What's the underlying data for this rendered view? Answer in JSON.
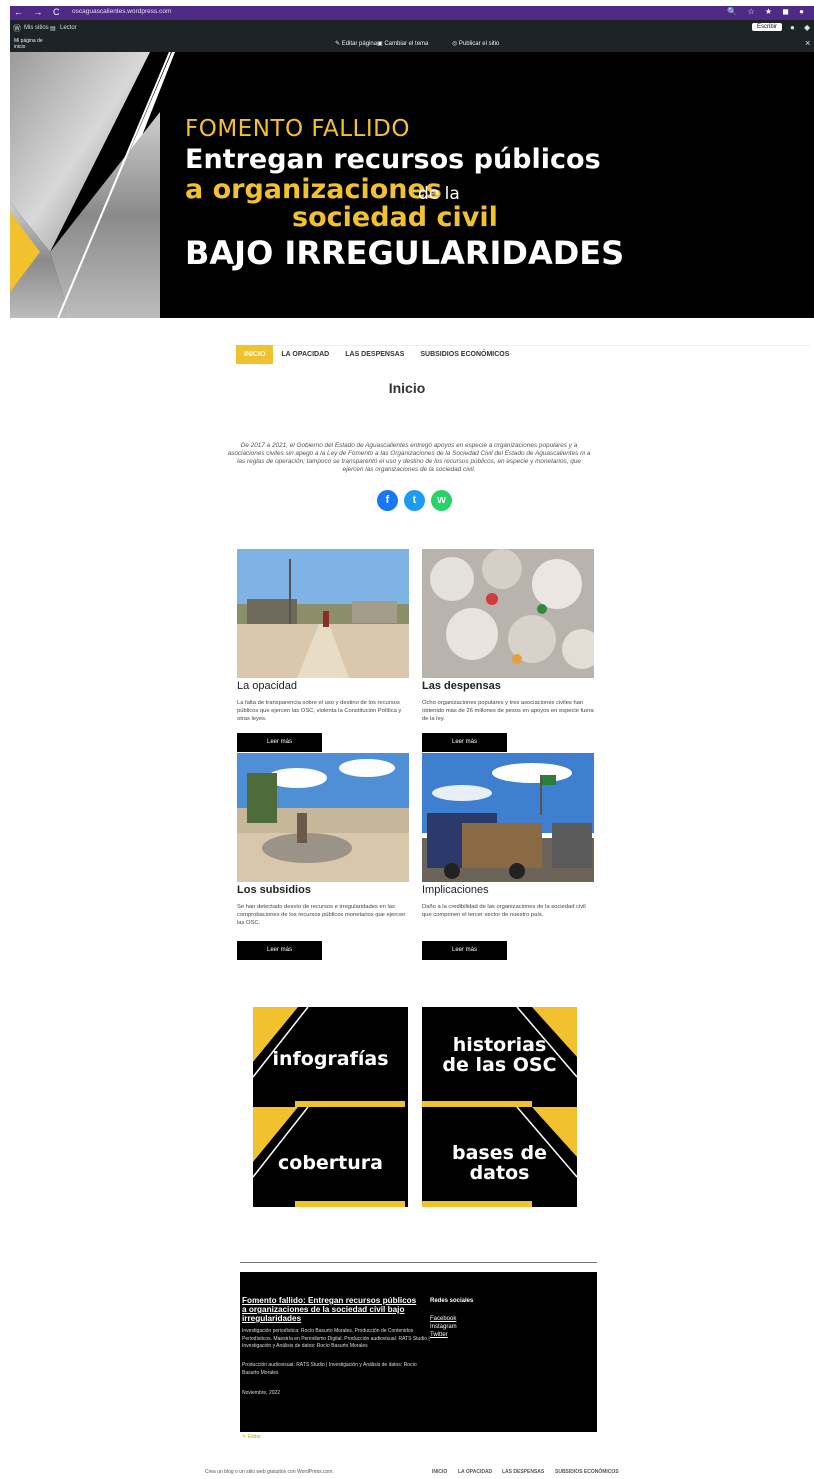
{
  "browser": {
    "url": "oscaguascalientes.wordpress.com",
    "nav_glyphs": "← → C",
    "right_glyphs": "🔍 ☆ ★ ◼ ●"
  },
  "admin_bar": {
    "my_sites": "Mis sitios",
    "reader": "Lector",
    "my_page": "Mi página de inicio",
    "edit_page": "Editar página",
    "change_theme": "Cambiar el tema",
    "publish_site": "Publicar el sitio",
    "write": "Escribir",
    "close": "×"
  },
  "hero": {
    "line1": "FOMENTO FALLIDO",
    "line2": "Entregan recursos públicos",
    "line3": "a organizaciones",
    "line3b": "de la",
    "line4": "sociedad civil",
    "line5": "BAJO IRREGULARIDADES"
  },
  "menu": [
    {
      "label": "INICIO",
      "active": true
    },
    {
      "label": "LA OPACIDAD",
      "active": false
    },
    {
      "label": "LAS DESPENSAS",
      "active": false
    },
    {
      "label": "SUBSIDIOS ECONÓMICOS",
      "active": false
    }
  ],
  "page_title": "Inicio",
  "intro": "De 2017 a 2021, el Gobierno del Estado de Aguascalientes entregó apoyos en especie a organizaciones populares y a asociaciones civiles sin apego a la Ley de Fomento a las Organizaciones de la Sociedad Civil del Estado de Aguascalientes ni a las reglas de operación; tampoco se transparentó el uso y destino de los recursos públicos, en especie y monetarios, que ejercen las organizaciones de la sociedad civil.",
  "share": {
    "facebook": "f",
    "twitter": "t",
    "whatsapp": "w"
  },
  "cards": [
    {
      "title": "La opacidad",
      "text": "La falta de transparencia sobre el uso y destino de los recursos públicos que ejercen las OSC, violenta la Constitución Política y otras leyes.",
      "button": "Leer más"
    },
    {
      "title": "Las despensas",
      "text": "Ocho organizaciones populares y tres asociaciones civiles han obtenido más de 26 millones de pesos en apoyos en especie fuera de la ley.",
      "button": "Leer más"
    },
    {
      "title": "Los subsidios",
      "text": "Se han detectado desvío de recursos e irregularidades en las comprobaciones de los recursos públicos monetarios que ejercen las OSC.",
      "button": "Leer más"
    },
    {
      "title": "Implicaciones",
      "text": "Daño a la credibilidad de las organizaciones de la sociedad civil que componen el tercer sector de nuestro país.",
      "button": "Leer más"
    }
  ],
  "tiles": {
    "infografias": "infografías",
    "historias_1": "historias",
    "historias_2": "de las OSC",
    "cobertura": "cobertura",
    "bases_1": "bases de",
    "bases_2": "datos"
  },
  "footer": {
    "title": "Fomento fallido: Entregan recursos públicos a organizaciones de la sociedad civil bajo irregularidades",
    "credits1": "Investigación periodística: Rocío Basurto Morales. Producción de Contenidos Periodísticos. Maestría en Periodismo Digital. Producción audiovisual: RATS Studio | Investigación y Análisis de datos: Rocío Basurto Morales",
    "credits2": "Producción audiovisual: RATS Studio | Investigación y Análisis de datos: Rocío Basurto Morales",
    "date": "Noviembre, 2022",
    "social_title": "Redes sociales",
    "social": [
      "Facebook",
      "Instagram",
      "Twitter"
    ],
    "edit": "✎ Editar"
  },
  "bottom": {
    "left": "Crea un blog o un sitio web gratuitos con WordPress.com.",
    "menu": [
      "INICIO",
      "LA OPACIDAD",
      "LAS DESPENSAS",
      "SUBSIDIOS ECONÓMICOS"
    ]
  },
  "colors": {
    "accent": "#f2c12e",
    "browser": "#4e2a84",
    "facebook": "#1877f2",
    "twitter": "#1d9bf0",
    "whatsapp": "#25d366"
  }
}
